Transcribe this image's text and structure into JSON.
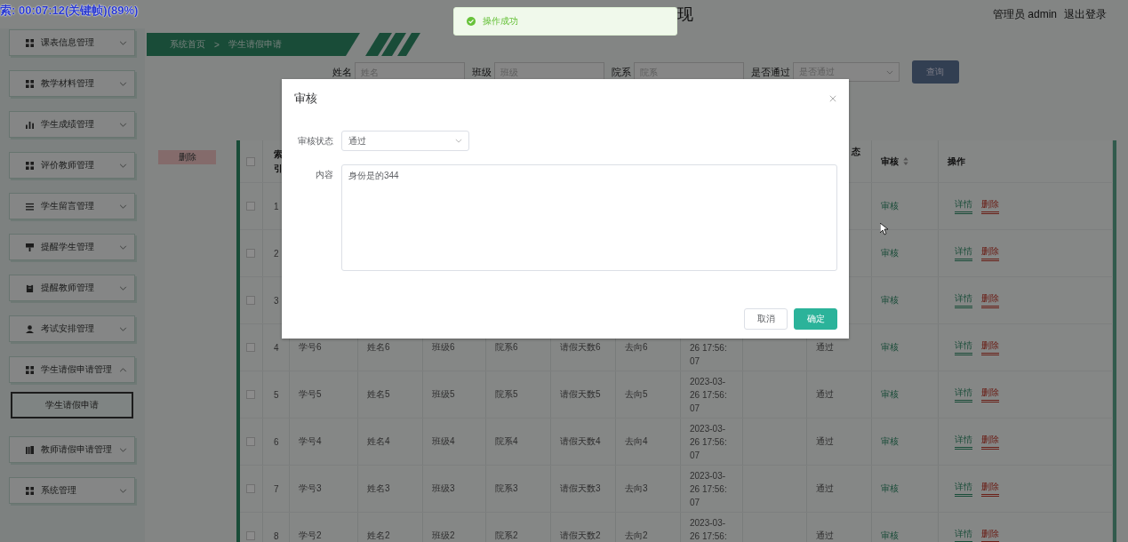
{
  "video_overlay": {
    "text": "索: 00:07:12(关键帧)(89%)"
  },
  "toast": {
    "text": "操作成功"
  },
  "header": {
    "title": "现",
    "user": "管理员 admin",
    "logout": "退出登录"
  },
  "sidebar": {
    "items": [
      {
        "label": "课表信息管理",
        "expanded": false
      },
      {
        "label": "教学材料管理",
        "expanded": false
      },
      {
        "label": "学生成绩管理",
        "expanded": false
      },
      {
        "label": "评价教师管理",
        "expanded": false
      },
      {
        "label": "学生留言管理",
        "expanded": false
      },
      {
        "label": "提醒学生管理",
        "expanded": false
      },
      {
        "label": "提醒教师管理",
        "expanded": false
      },
      {
        "label": "考试安排管理",
        "expanded": false
      },
      {
        "label": "学生请假申请管理",
        "expanded": true,
        "children": [
          {
            "label": "学生请假申请",
            "selected": true
          }
        ]
      },
      {
        "label": "教师请假申请管理",
        "expanded": false
      },
      {
        "label": "系统管理",
        "expanded": false
      }
    ]
  },
  "breadcrumb": {
    "items": [
      "系统首页",
      "学生请假申请"
    ],
    "separator": ">"
  },
  "search": {
    "fields": [
      {
        "label": "姓名",
        "placeholder": "姓名",
        "kind": "input"
      },
      {
        "label": "班级",
        "placeholder": "班级",
        "kind": "input"
      },
      {
        "label": "院系",
        "placeholder": "院系",
        "kind": "input"
      },
      {
        "label": "是否通过",
        "placeholder": "是否通过",
        "kind": "select"
      }
    ],
    "button": "查询"
  },
  "delete_button": "删除",
  "table": {
    "select_all_checked": false,
    "columns": [
      {
        "kind": "index",
        "label": "索引"
      },
      {
        "kind": "text"
      },
      {
        "kind": "text"
      },
      {
        "kind": "text"
      },
      {
        "kind": "text"
      },
      {
        "kind": "text"
      },
      {
        "kind": "text"
      },
      {
        "kind": "time"
      },
      {
        "kind": "text"
      },
      {
        "kind": "status",
        "label": "态"
      },
      {
        "kind": "review",
        "label": "审核",
        "sortable": true
      },
      {
        "kind": "actions",
        "label": "操作"
      }
    ],
    "rows": [
      {
        "checked": false,
        "cells": [
          "1",
          null,
          null,
          null,
          null,
          null,
          null,
          null,
          null,
          null,
          "审核",
          [
            "详情",
            "删除"
          ]
        ]
      },
      {
        "checked": false,
        "cells": [
          "2",
          null,
          null,
          null,
          null,
          null,
          null,
          null,
          null,
          null,
          "审核",
          [
            "详情",
            "删除"
          ]
        ]
      },
      {
        "checked": false,
        "cells": [
          "3",
          null,
          null,
          null,
          null,
          null,
          null,
          null,
          null,
          null,
          "审核",
          [
            "详情",
            "删除"
          ]
        ]
      },
      {
        "checked": false,
        "cells": [
          "4",
          "学号6",
          "姓名6",
          "班级6",
          "院系6",
          "请假天数6",
          "去向6",
          [
            null,
            "26 17:56:",
            "07"
          ],
          null,
          "通过",
          "审核",
          [
            "详情",
            "删除"
          ]
        ]
      },
      {
        "checked": false,
        "cells": [
          "5",
          "学号5",
          "姓名5",
          "班级5",
          "院系5",
          "请假天数5",
          "去向5",
          [
            "2023-03-",
            "26 17:56:",
            "07"
          ],
          null,
          "通过",
          "审核",
          [
            "详情",
            "删除"
          ]
        ]
      },
      {
        "checked": false,
        "cells": [
          "6",
          "学号4",
          "姓名4",
          "班级4",
          "院系4",
          "请假天数4",
          "去向4",
          [
            "2023-03-",
            "26 17:56:",
            "07"
          ],
          null,
          "通过",
          "审核",
          [
            "详情",
            "删除"
          ]
        ]
      },
      {
        "checked": false,
        "cells": [
          "7",
          "学号3",
          "姓名3",
          "班级3",
          "院系3",
          "请假天数3",
          "去向3",
          [
            "2023-03-",
            "26 17:56:",
            "07"
          ],
          null,
          "通过",
          "审核",
          [
            "详情",
            "删除"
          ]
        ]
      },
      {
        "checked": false,
        "cells": [
          "8",
          "学号2",
          "姓名2",
          "班级2",
          "院系2",
          "请假天数2",
          "去向2",
          [
            "2023-03-",
            "26 17:56:",
            null
          ],
          null,
          "通过",
          "审核",
          [
            "详情",
            "删除"
          ]
        ]
      }
    ]
  },
  "modal": {
    "title": "审核",
    "fields": [
      {
        "label": "审核状态",
        "kind": "select",
        "value": "通过"
      },
      {
        "label": "内容",
        "kind": "textarea",
        "value": "身份是的344"
      }
    ],
    "buttons": [
      {
        "label": "取消",
        "kind": "default"
      },
      {
        "label": "确定",
        "kind": "primary"
      }
    ]
  }
}
